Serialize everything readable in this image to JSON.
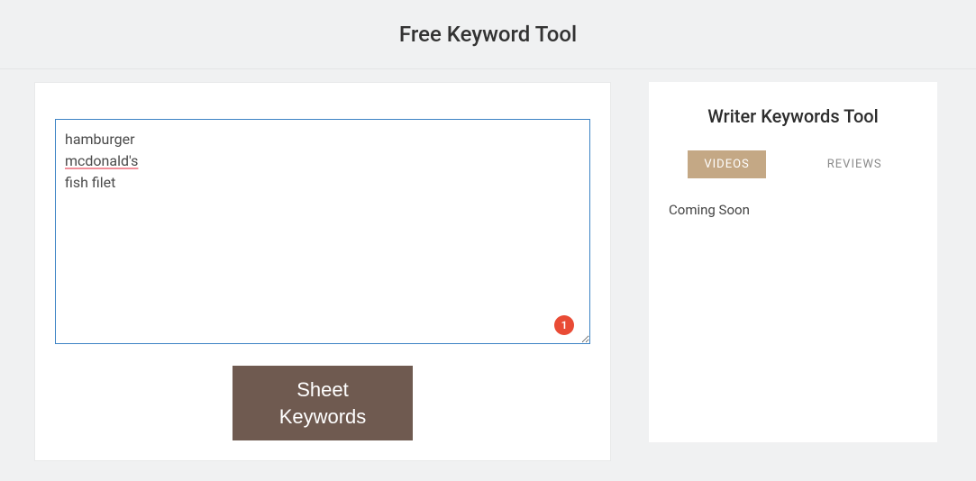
{
  "header": {
    "title": "Free Keyword Tool"
  },
  "main": {
    "textarea_lines": [
      "hamburger",
      "mcdonald's",
      "fish filet"
    ],
    "badge_count": "1",
    "button_line1": "Sheet",
    "button_line2": "Keywords"
  },
  "sidebar": {
    "title": "Writer Keywords Tool",
    "tabs": {
      "videos": "VIDEOS",
      "reviews": "REVIEWS"
    },
    "content": "Coming Soon"
  }
}
